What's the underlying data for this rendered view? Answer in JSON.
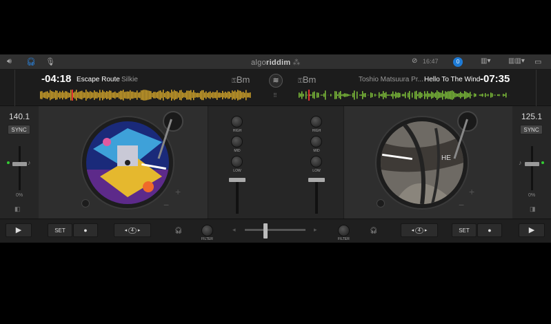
{
  "app": {
    "brand_light": "algo",
    "brand_bold": "riddim",
    "clock": "16:47",
    "badge": "0"
  },
  "colors": {
    "accent": "#1e7bd6",
    "wave_left": "#d6a72a",
    "wave_right": "#7fc23a",
    "playhead": "#e03030"
  },
  "topbar_icons": [
    "speaker-icon",
    "headphones-icon",
    "microphone-icon",
    "grid-icon",
    "clock-icon",
    "layout-icon",
    "columns-icon",
    "screen-icon"
  ],
  "left": {
    "time": "-04:18",
    "title": "Escape Route",
    "artist": "Silkie",
    "key": "Bm",
    "bpm": "140.1",
    "sync": "SYNC",
    "pitch": "0%",
    "play": "▶",
    "set": "SET",
    "loop_count": "4",
    "filter": "FILTER"
  },
  "right": {
    "time": "-07:35",
    "title": "Hello To The Wind",
    "artist": "Toshio Matsuura Pr...",
    "key": "Bm",
    "bpm": "125.1",
    "sync": "SYNC",
    "pitch": "0%",
    "play": "▶",
    "set": "SET",
    "loop_count": "4",
    "filter": "FILTER"
  },
  "mixer": {
    "high": "HIGH",
    "mid": "MID",
    "low": "LOW"
  }
}
